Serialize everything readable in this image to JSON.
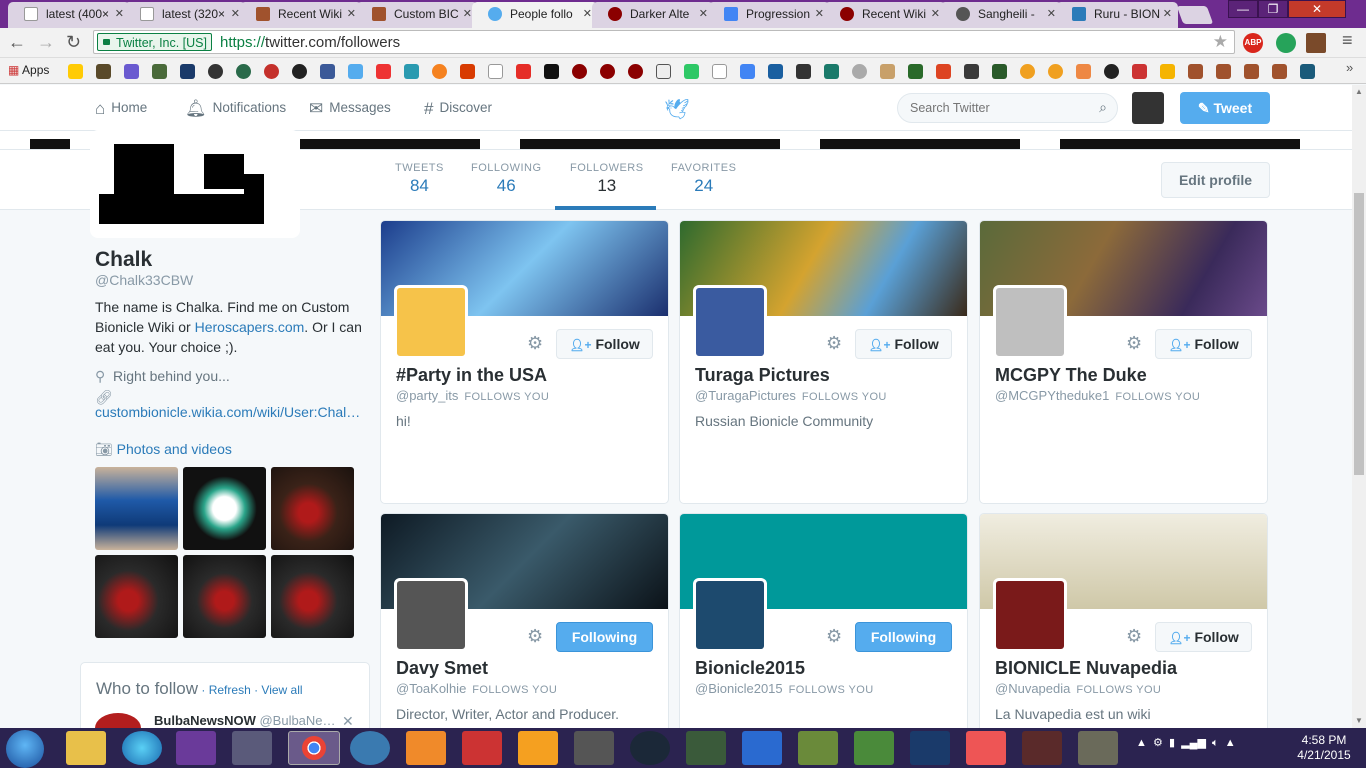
{
  "browser": {
    "tabs": [
      {
        "label": "latest (400×",
        "color": "#ffffff"
      },
      {
        "label": "latest (320×",
        "color": "#ffffff"
      },
      {
        "label": "Recent Wiki",
        "color": "#a0522d"
      },
      {
        "label": "Custom BIC",
        "color": "#a0522d"
      },
      {
        "label": "People follo",
        "color": "#55acee"
      },
      {
        "label": "Darker Alte",
        "color": "#8b0000"
      },
      {
        "label": "Progression",
        "color": "#4285f4"
      },
      {
        "label": "Recent Wiki",
        "color": "#8b0000"
      },
      {
        "label": "Sangheili -",
        "color": "#555555"
      },
      {
        "label": "Ruru - BION",
        "color": "#2b7bb9"
      }
    ],
    "cert_label": "Twitter, Inc. [US]",
    "url_scheme": "https://",
    "url_rest": "twitter.com/followers",
    "apps_label": "Apps",
    "ext_abp": "ABP"
  },
  "twitter_nav": {
    "home": "Home",
    "notifications": "Notifications",
    "messages": "Messages",
    "discover": "Discover",
    "search_placeholder": "Search Twitter",
    "tweet_button": "Tweet"
  },
  "stats": {
    "tweets_label": "TWEETS",
    "tweets": "84",
    "following_label": "FOLLOWING",
    "following": "46",
    "followers_label": "FOLLOWERS",
    "followers": "13",
    "favorites_label": "FAVORITES",
    "favorites": "24",
    "edit_profile": "Edit profile"
  },
  "profile": {
    "name": "Chalk",
    "handle": "@Chalk33CBW",
    "bio_part1": "The name is Chalka. Find me on Custom Bionicle Wiki or ",
    "bio_link": "Heroscapers.com",
    "bio_part2": ". Or I can eat you. Your choice ;).",
    "location": "Right behind you...",
    "website": "custombionicle.wikia.com/wiki/User:Chal…",
    "photos_label": "Photos and videos"
  },
  "who_to_follow": {
    "title": "Who to follow",
    "refresh": "Refresh",
    "view_all": "View all",
    "sep1": " · ",
    "sep2": " · ",
    "user_name": "BulbaNewsNOW",
    "user_handle": "@BulbaNe…",
    "dismiss": "✕"
  },
  "follow_label": "Follow",
  "following_label": "Following",
  "follows_you": "FOLLOWS YOU",
  "cards": [
    {
      "name": "#Party in the USA",
      "handle": "@party_its",
      "bio": "hi!",
      "following": false,
      "banner": "linear-gradient(135deg,#1c3d8c,#7ec4f0 50%,#1b2f6e)",
      "avatar": "#f6c34a"
    },
    {
      "name": "Turaga Pictures",
      "handle": "@TuragaPictures",
      "bio": "Russian Bionicle Community",
      "following": false,
      "banner": "linear-gradient(120deg,#2e6a2e,#d4a32f 45%,#5aa0d6 70%,#3a2a1a)",
      "avatar": "#3a5ba0"
    },
    {
      "name": "MCGPY The Duke",
      "handle": "@MCGPYtheduke1",
      "bio": "",
      "following": false,
      "banner": "linear-gradient(120deg,#5a6a3a,#8c6a3a 40%,#3a2a5a 75%,#6a4a8a)",
      "avatar": "#bfbfbf"
    },
    {
      "name": "Davy Smet",
      "handle": "@ToaKolhie",
      "bio": "Director, Writer, Actor and Producer.",
      "following": true,
      "banner": "linear-gradient(135deg,#0e1a24,#3a5a6a 50%,#0b1218)",
      "avatar": "#555555"
    },
    {
      "name": "Bionicle2015",
      "handle": "@Bionicle2015",
      "bio": "",
      "following": true,
      "banner": "#00999a",
      "avatar": "#1d4a6e"
    },
    {
      "name": "BIONICLE Nuvapedia",
      "handle": "@Nuvapedia",
      "bio": "La Nuvapedia est un wiki",
      "following": false,
      "banner": "linear-gradient(180deg,#f0ede0,#cfc8a8)",
      "avatar": "#7a1a1a"
    }
  ],
  "clock": {
    "time": "4:58 PM",
    "date": "4/21/2015"
  }
}
